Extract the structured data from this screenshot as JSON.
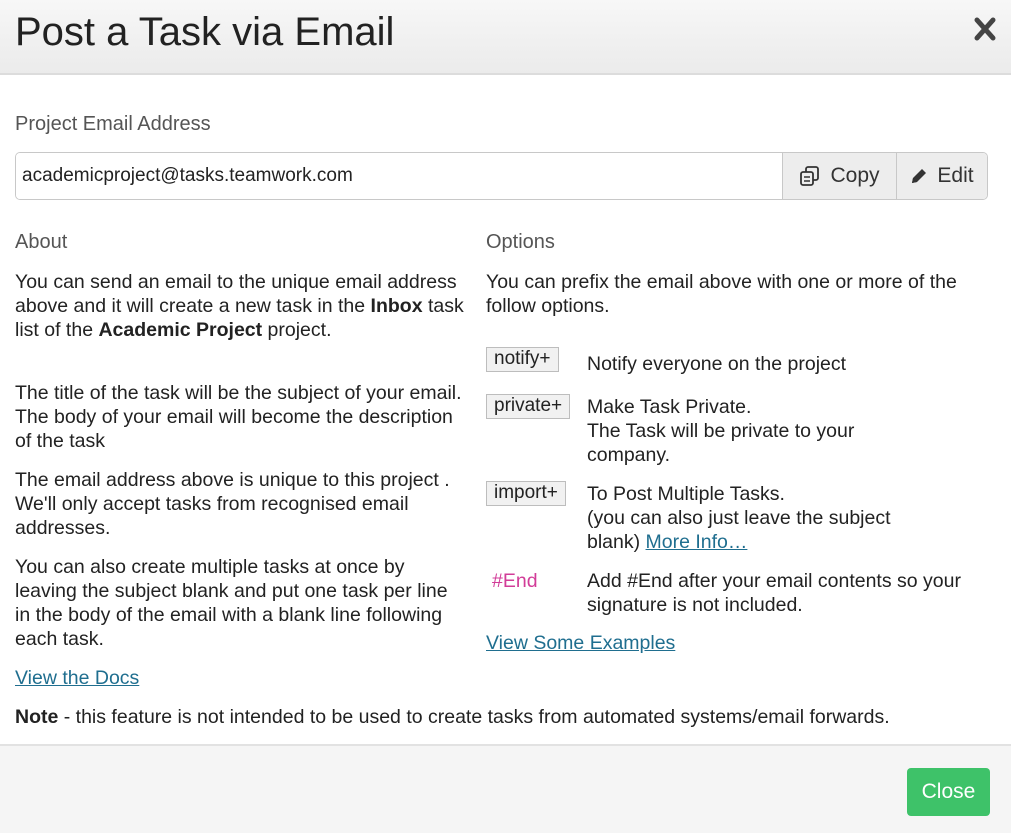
{
  "dialog": {
    "title": "Post a Task via Email",
    "close_icon": "close-x-icon"
  },
  "email": {
    "label": "Project Email Address",
    "value": "academicproject@tasks.teamwork.com",
    "copy_label": "Copy",
    "copy_icon": "copy-icon",
    "edit_label": "Edit",
    "edit_icon": "pencil-icon"
  },
  "about": {
    "heading": "About",
    "p1_a": "You can send an email to the unique email address above and it will create a new task in the ",
    "p1_bold1": "Inbox",
    "p1_b": " task list of the ",
    "p1_bold2": "Academic Project",
    "p1_c": " project.",
    "p2": "The title of the task will be the subject of your email. The body of your email will become the description of the task",
    "p3": "The email address above is unique to this project . We'll only accept tasks from recognised email addresses.",
    "p4": "You can also create multiple tasks at once by leaving the subject blank and put one task per line in the body of the email with a blank line following each task.",
    "docs_link": "View the Docs"
  },
  "options": {
    "heading": "Options",
    "intro": "You can prefix the email above with one or more of the follow options.",
    "items": [
      {
        "tag": "notify+",
        "text": "Notify everyone on the project"
      },
      {
        "tag": "private+",
        "text": "Make Task Private.",
        "text2": "The Task will be private to your company."
      },
      {
        "tag": "import+",
        "text": "To Post Multiple Tasks.",
        "text2": "(you can also just leave the subject blank) ",
        "link": "More Info…"
      },
      {
        "tag": "#End",
        "text": "Add #End after your email contents so your signature is not included."
      }
    ],
    "examples_link": "View Some Examples"
  },
  "note": {
    "bold": "Note",
    "text": " - this feature is not intended to be used to create tasks from automated systems/email forwards."
  },
  "footer": {
    "close_label": "Close",
    "close_color": "#3ec269"
  },
  "colors": {
    "link": "#1f6e8f",
    "end_tag": "#d23c98"
  }
}
